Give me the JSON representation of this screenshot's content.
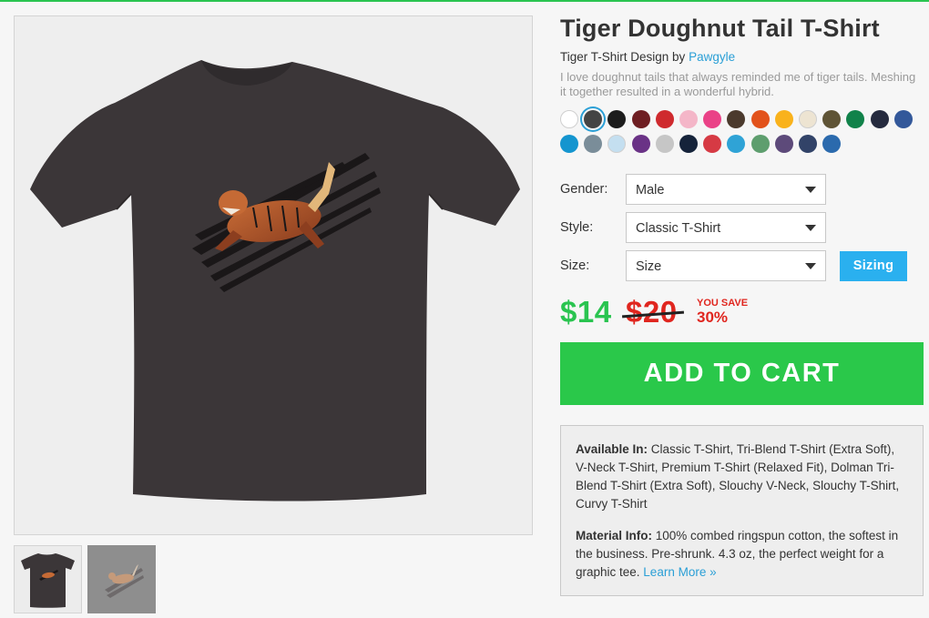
{
  "product": {
    "title": "Tiger Doughnut Tail T-Shirt",
    "byline_prefix": "Tiger T-Shirt Design by ",
    "artist": "Pawgyle",
    "description": "I love doughnut tails that always reminded me of tiger tails. Meshing it together resulted in a wonderful hybrid."
  },
  "colors": {
    "selected_index": 1,
    "row1": [
      "#ffffff",
      "#444444",
      "#1c1c1c",
      "#6e1e22",
      "#cf2a2e",
      "#f4b6c8",
      "#ea4287",
      "#4b3a2d",
      "#e2521b",
      "#f9b21c",
      "#ede4d2",
      "#5f5436",
      "#11824a",
      "#252a3e",
      "#33589a"
    ],
    "row2": [
      "#1495cf",
      "#7a8d99",
      "#c4dff0",
      "#6a3286",
      "#c6c6c6",
      "#15233a",
      "#d63a44",
      "#2fa3d6",
      "#5e9e6e",
      "#5d4a7a",
      "#324368",
      "#2b6aad"
    ]
  },
  "options": {
    "gender_label": "Gender:",
    "gender_value": "Male",
    "style_label": "Style:",
    "style_value": "Classic T-Shirt",
    "size_label": "Size:",
    "size_value": "Size",
    "sizing_button": "Sizing"
  },
  "pricing": {
    "price": "$14",
    "old_price": "$20",
    "you_save": "YOU SAVE",
    "save_percent": "30%"
  },
  "cart": {
    "button_label": "ADD TO CART"
  },
  "info": {
    "available_label": "Available In:",
    "available_text": " Classic T-Shirt, Tri-Blend T-Shirt (Extra Soft), V-Neck T-Shirt, Premium T-Shirt (Relaxed Fit), Dolman Tri-Blend T-Shirt (Extra Soft), Slouchy V-Neck, Slouchy T-Shirt, Curvy T-Shirt",
    "material_label": "Material Info:",
    "material_text": " 100% combed ringspun cotton, the softest in the business. Pre-shrunk. 4.3 oz, the perfect weight for a graphic tee. ",
    "learn_more": "Learn More »"
  },
  "images": {
    "shirt_color": "#3b3638",
    "thumb2_background": "#8e8e8e"
  }
}
